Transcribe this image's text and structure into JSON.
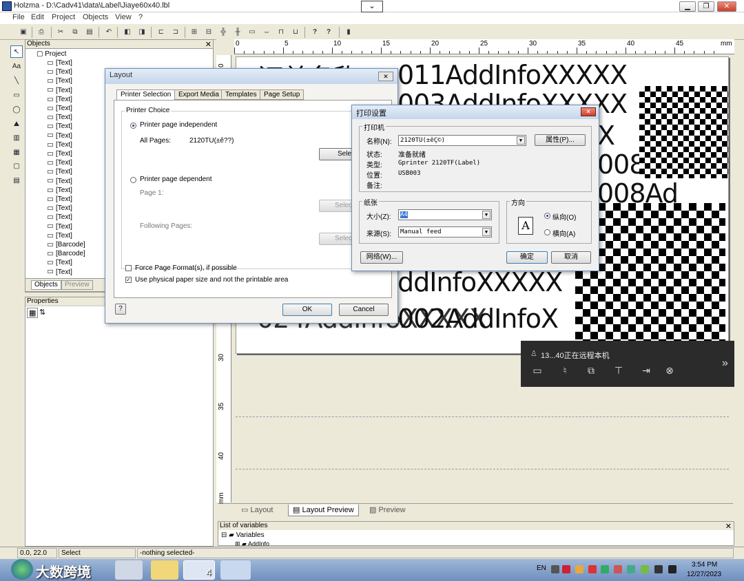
{
  "window": {
    "title": "Holzma - D:\\Cadv41\\data\\Label\\Jiaye60x40.lbl",
    "minimize": "▁",
    "maximize": "❐",
    "close": "✕",
    "remote_toggle": "⌄"
  },
  "menu": [
    "File",
    "Edit",
    "Project",
    "Objects",
    "View",
    "?"
  ],
  "toolbar_icons": [
    "save-icon",
    "print-icon",
    "cut-icon",
    "copy-icon",
    "paste-icon",
    "undo-icon",
    "group-icon",
    "ungroup-icon",
    "align-left-icon",
    "align-right-icon",
    "distribute-h-icon",
    "distribute-v-icon",
    "space-h-icon",
    "space-v-icon",
    "size-icon",
    "same-width-icon",
    "same-height-icon",
    "help-icon",
    "context-help-icon",
    "pin-icon"
  ],
  "objects_panel": {
    "title": "Objects",
    "close": "✕",
    "root": "Project",
    "items": [
      "[Text]",
      "[Text]",
      "[Text]",
      "[Text]",
      "[Text]",
      "[Text]",
      "[Text]",
      "[Text]",
      "[Text]",
      "[Text]",
      "[Text]",
      "[Text]",
      "[Text]",
      "[Text]",
      "[Text]",
      "[Text]",
      "[Text]",
      "[Text]",
      "[Text]",
      "[Text]",
      "[Barcode]",
      "[Barcode]",
      "[Text]",
      "[Text]"
    ],
    "tabs": [
      "Objects",
      "Preview"
    ]
  },
  "properties_panel": {
    "title": "Properties"
  },
  "ruler": {
    "top_labels": [
      "0",
      "5",
      "10",
      "15",
      "20",
      "25",
      "30",
      "35",
      "40",
      "45",
      "mm"
    ],
    "left_labels": [
      "0",
      "30",
      "35",
      "40",
      "mm"
    ]
  },
  "label_content": {
    "lines": [
      "订单名称",
      "011AddInfoXXXXX",
      "003AddInfoXXXXX",
      "X",
      "008",
      "008Ad",
      "ddInfoXXXXX",
      "024AddInfoXXXXX",
      "002AddInfoX"
    ]
  },
  "view_tabs": [
    "Layout",
    "Layout Preview",
    "Preview"
  ],
  "variables_panel": {
    "title": "List of variables",
    "root": "Variables",
    "child": "AddInfo",
    "close": "✕"
  },
  "status_bar": {
    "coords": "0.0, 22.0",
    "mode": "Select",
    "selection": "-nothing selected-"
  },
  "layout_dialog": {
    "title": "Layout",
    "close": "✕",
    "tabs": [
      "Printer Selection",
      "Export Media",
      "Templates",
      "Page Setup"
    ],
    "group_title": "Printer Choice",
    "independent_label": "Printer page independent",
    "all_pages_label": "All Pages:",
    "all_pages_value": "2120TU(±ê??)",
    "select_label": "Select",
    "dependent_label": "Printer page dependent",
    "page1_label": "Page 1:",
    "following_label": "Following Pages:",
    "force_format_label": "Force Page Format(s), if possible",
    "physical_paper_label": "Use physical paper size and not the printable area",
    "ok": "OK",
    "cancel": "Cancel",
    "help": "?"
  },
  "print_dialog": {
    "title": "打印设置",
    "close": "✕",
    "printer_group": "打印机",
    "name_label": "名称(N):",
    "name_value": "2120TU(±êÇ©)",
    "properties_button": "属性(P)...",
    "status_label": "状态:",
    "status_value": "准备就绪",
    "type_label": "类型:",
    "type_value": "Gprinter 2120TF(Label)",
    "location_label": "位置:",
    "location_value": "USB003",
    "comment_label": "备注:",
    "paper_group": "纸张",
    "size_label": "大小(Z):",
    "size_value": "A4",
    "source_label": "来源(S):",
    "source_value": "Manual feed",
    "orientation_group": "方向",
    "portrait_label": "纵向(O)",
    "landscape_label": "横向(A)",
    "network_button": "网络(W)...",
    "ok_button": "确定",
    "cancel_button": "取消"
  },
  "remote_toolbar": {
    "status": "13...40正在远程本机",
    "expand": "»"
  },
  "taskbar": {
    "watermark": "大数跨境",
    "lang": "EN",
    "time": "3:54 PM",
    "date": "12/27/2023",
    "badge": "4"
  },
  "colors": {
    "accent": "#3a76d2",
    "titlebar_gradient": "#c5d6ea",
    "taskbar": "#6e8fbf"
  }
}
